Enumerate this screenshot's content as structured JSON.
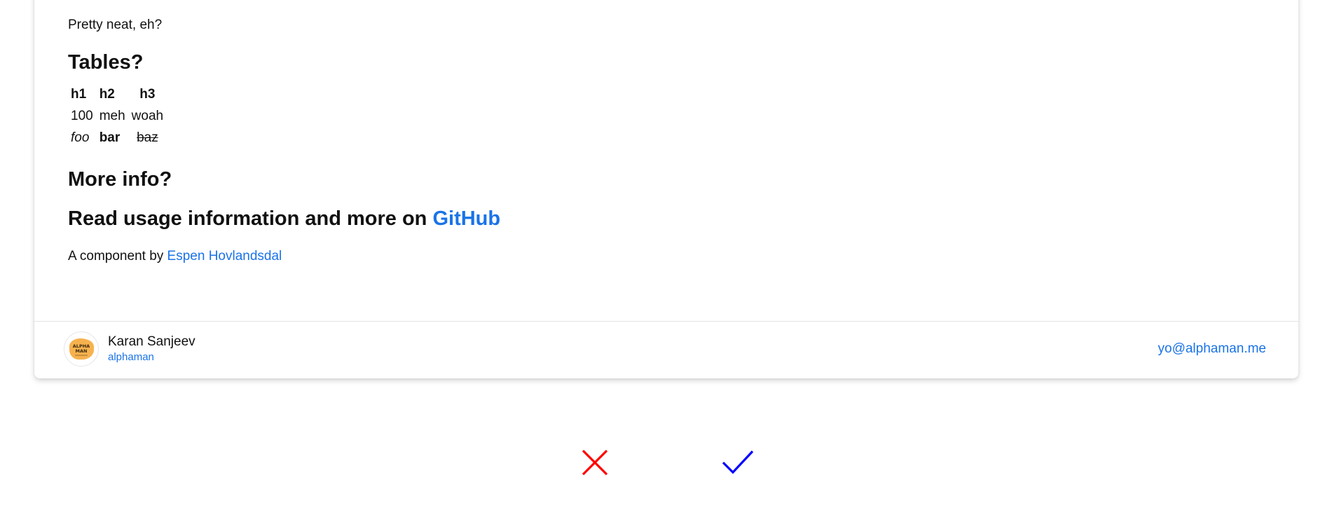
{
  "intro_text": "Pretty neat, eh?",
  "sections": {
    "tables_heading": "Tables?",
    "more_heading": "More info?",
    "read_prefix": "Read usage information and more on ",
    "read_link": "GitHub"
  },
  "table": {
    "headers": [
      "h1",
      "h2",
      "h3"
    ],
    "rows": [
      [
        "100",
        "meh",
        "woah"
      ],
      [
        "foo",
        "bar",
        "baz"
      ]
    ]
  },
  "credit": {
    "prefix": "A component by ",
    "author_link": "Espen Hovlandsdal"
  },
  "footer": {
    "name": "Karan Sanjeev",
    "handle": "alphaman",
    "email": "yo@alphaman.me",
    "avatar_text": [
      "ALPHA",
      "MAN"
    ]
  },
  "actions": {
    "reject_icon": "close-icon",
    "accept_icon": "checkmark-icon"
  },
  "colors": {
    "link": "#1a73e8",
    "reject": "#ff0000",
    "accept": "#0000ff",
    "avatar": "#f7b24e"
  }
}
